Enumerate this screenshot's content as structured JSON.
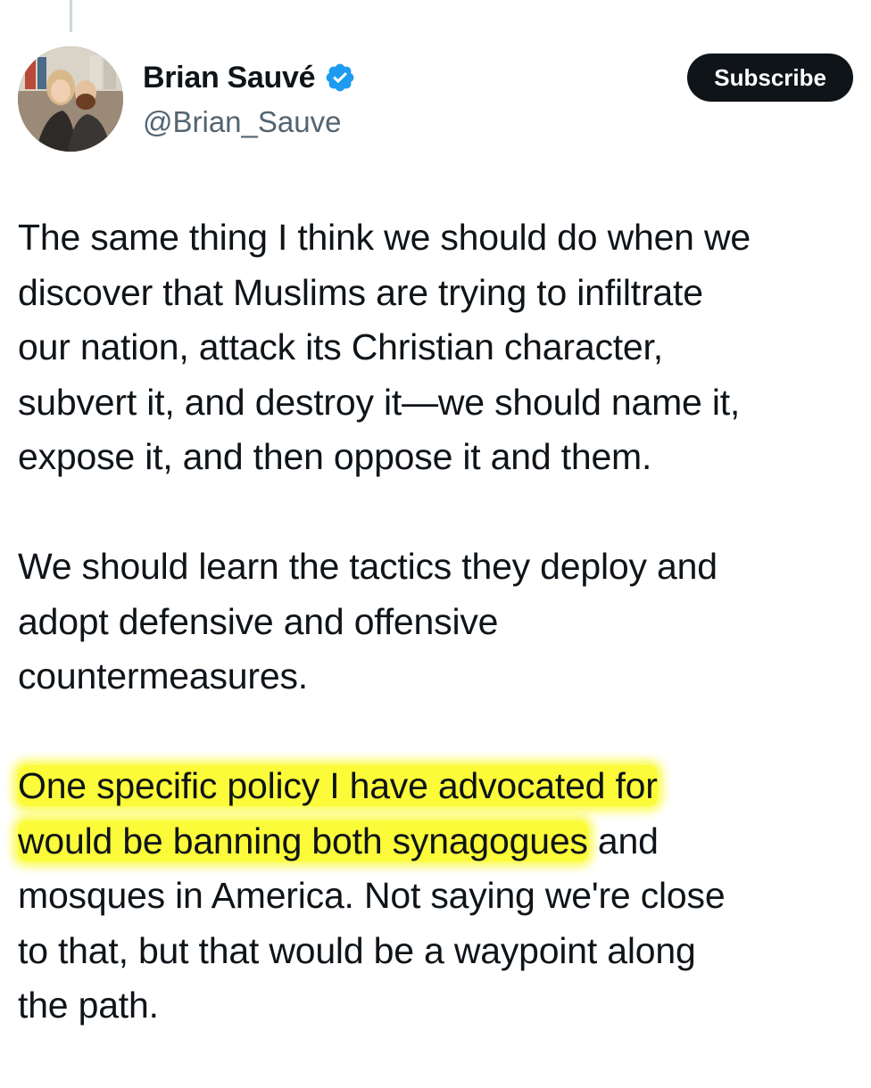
{
  "author": {
    "display_name": "Brian Sauvé",
    "handle": "@Brian_Sauve",
    "verified_icon": "verified-badge-icon",
    "avatar": "profile-photo-avatar"
  },
  "actions": {
    "subscribe_label": "Subscribe"
  },
  "tweet": {
    "paragraph1": [
      "The same thing I think we should do when we",
      "discover that Muslims are trying to infiltrate",
      "our nation, attack its Christian character,",
      "subvert it, and destroy it—we should name it,",
      "expose it, and then oppose it and them."
    ],
    "paragraph2": [
      "We should learn the tactics they deploy and",
      "adopt defensive and offensive",
      "countermeasures."
    ],
    "paragraph3": {
      "highlighted_line1": "One specific policy I have advocated for",
      "highlighted_line2": "would be banning both synagogues",
      "line2_rest": " and",
      "line3": "mosques in America. Not saying we're close",
      "line4": "to that, but that would be a waypoint along",
      "line5": "the path."
    }
  },
  "colors": {
    "text": "#0f1419",
    "secondary_text": "#536471",
    "verified_blue": "#1d9bf0",
    "button_bg": "#0f1419",
    "highlight": "#fafa1e"
  }
}
